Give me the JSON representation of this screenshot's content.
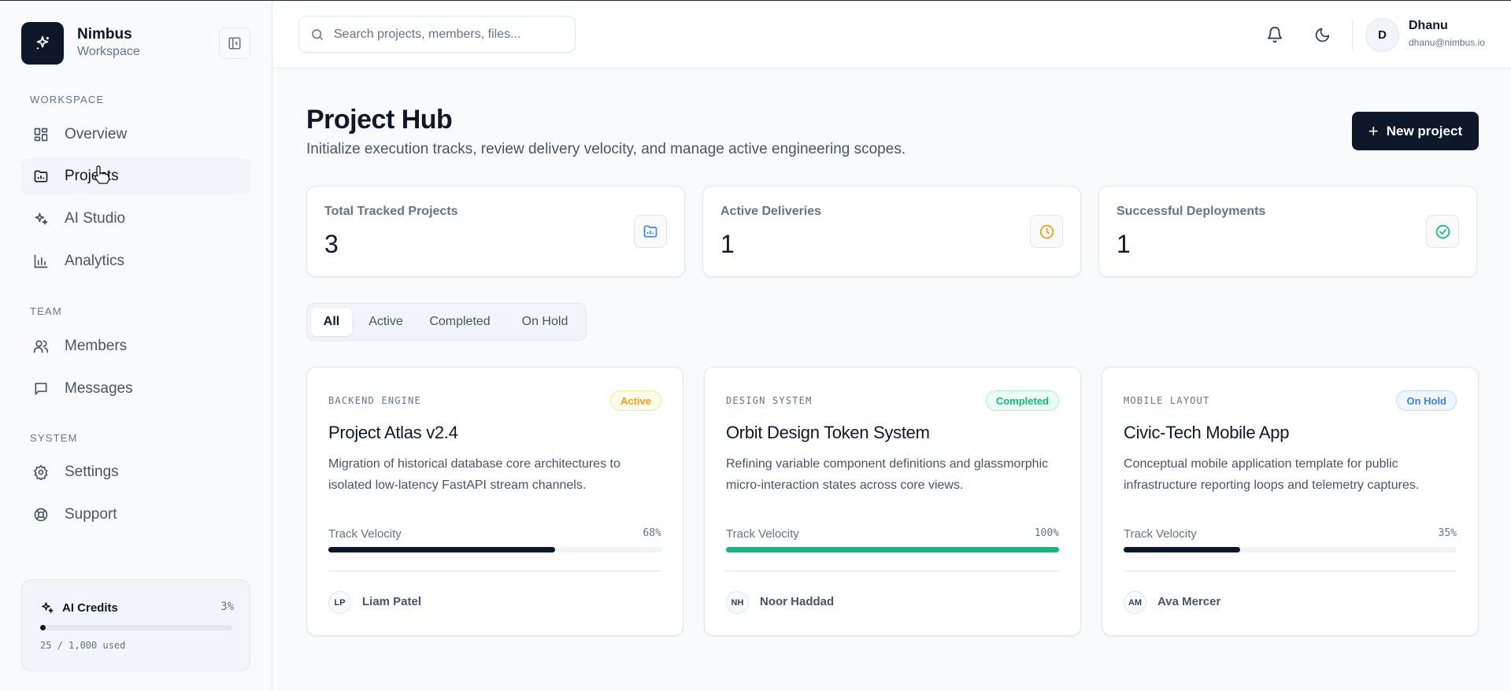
{
  "brand": {
    "name": "Nimbus",
    "subtitle": "Workspace"
  },
  "sidebar": {
    "sections": [
      {
        "title": "WORKSPACE"
      },
      {
        "title": "TEAM"
      },
      {
        "title": "SYSTEM"
      }
    ],
    "items": [
      {
        "label": "Overview",
        "icon": "grid-icon"
      },
      {
        "label": "Projects",
        "icon": "folder-chart-icon",
        "active": true
      },
      {
        "label": "AI Studio",
        "icon": "sparkles-icon"
      },
      {
        "label": "Analytics",
        "icon": "bar-chart-icon"
      },
      {
        "label": "Members",
        "icon": "users-icon"
      },
      {
        "label": "Messages",
        "icon": "message-icon"
      },
      {
        "label": "Settings",
        "icon": "gear-icon"
      },
      {
        "label": "Support",
        "icon": "lifebuoy-icon"
      }
    ],
    "credits": {
      "title": "AI Credits",
      "percent_label": "3%",
      "percent": 3,
      "used": "25 / 1,000 used"
    }
  },
  "topbar": {
    "search_placeholder": "Search projects, members, files...",
    "user": {
      "initial": "D",
      "name": "Dhanu",
      "email": "dhanu@nimbus.io"
    }
  },
  "header": {
    "title": "Project Hub",
    "subtitle": "Initialize execution tracks, review delivery velocity, and manage active engineering scopes.",
    "new_button": "New project"
  },
  "stats": [
    {
      "label": "Total Tracked Projects",
      "value": "3",
      "icon": "folder-chart-icon",
      "color": "#3b82f6"
    },
    {
      "label": "Active Deliveries",
      "value": "1",
      "icon": "clock-icon",
      "color": "#f59e0b"
    },
    {
      "label": "Successful Deployments",
      "value": "1",
      "icon": "check-circle-icon",
      "color": "#10b981"
    }
  ],
  "filters": [
    "All",
    "Active",
    "Completed",
    "On Hold"
  ],
  "active_filter": "All",
  "projects": [
    {
      "category": "BACKEND ENGINE",
      "status": "Active",
      "status_colors": {
        "fg": "#f59e0b",
        "bg": "#fffbeb",
        "border": "#fde68a"
      },
      "title": "Project Atlas v2.4",
      "description": "Migration of historical database core architectures to isolated low-latency FastAPI stream channels.",
      "velocity_label": "Track Velocity",
      "velocity_pct_label": "68%",
      "velocity": 68,
      "bar_color": "#0f172a",
      "owner_initials": "LP",
      "owner_name": "Liam Patel"
    },
    {
      "category": "DESIGN SYSTEM",
      "status": "Completed",
      "status_colors": {
        "fg": "#10b981",
        "bg": "#ecfdf5",
        "border": "#a7f3d0"
      },
      "title": "Orbit Design Token System",
      "description": "Refining variable component definitions and glassmorphic micro-interaction states across core views.",
      "velocity_label": "Track Velocity",
      "velocity_pct_label": "100%",
      "velocity": 100,
      "bar_color": "#10b981",
      "owner_initials": "NH",
      "owner_name": "Noor Haddad"
    },
    {
      "category": "MOBILE LAYOUT",
      "status": "On Hold",
      "status_colors": {
        "fg": "#3b82f6",
        "bg": "#eff6ff",
        "border": "#bfdbfe"
      },
      "title": "Civic-Tech Mobile App",
      "description": "Conceptual mobile application template for public infrastructure reporting loops and telemetry captures.",
      "velocity_label": "Track Velocity",
      "velocity_pct_label": "35%",
      "velocity": 35,
      "bar_color": "#0f172a",
      "owner_initials": "AM",
      "owner_name": "Ava Mercer"
    }
  ]
}
